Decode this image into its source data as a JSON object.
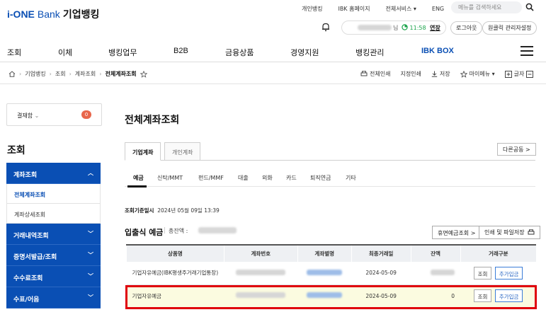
{
  "header": {
    "logo_brand": "i-ONE",
    "logo_bank": "Bank",
    "logo_kr": "기업뱅킹",
    "util_links": [
      "개인뱅킹",
      "IBK 홈페이지",
      "전체서비스 ▾",
      "ENG"
    ],
    "search_placeholder": "메뉴를 검색하세요",
    "user_suffix": "님",
    "timer": "11:58",
    "extend_label": "연장",
    "logout_label": "로그아웃",
    "cert_manager_label": "원클릭 관리자설정"
  },
  "gnb": [
    "조회",
    "이체",
    "뱅킹업무",
    "B2B",
    "금융상품",
    "경영지원",
    "뱅킹관리",
    "IBK BOX"
  ],
  "breadcrumb": [
    "기업뱅킹",
    "조회",
    "계좌조회",
    "전체계좌조회"
  ],
  "tools": [
    "전체인쇄",
    "지정인쇄",
    "저장",
    "마이메뉴 ▾",
    "글자"
  ],
  "sidebar": {
    "settle_label": "결재함",
    "settle_count": "0",
    "title": "조회",
    "sections": [
      {
        "label": "계좌조회",
        "open": true,
        "subs": [
          "전체계좌조회",
          "계좌상세조회"
        ]
      },
      {
        "label": "거래내역조회"
      },
      {
        "label": "증명서발급/조회"
      },
      {
        "label": "수수료조회"
      },
      {
        "label": "수표/어음"
      }
    ]
  },
  "main": {
    "title": "전체계좌조회",
    "account_tabs": [
      "기업계좌",
      "개인계좌"
    ],
    "others_button": "다른공동 >",
    "subtabs": [
      "예금",
      "신탁/MMT",
      "펀드/MMF",
      "대출",
      "외화",
      "카드",
      "퇴직연금",
      "기타"
    ],
    "inquiry_label": "조회기준일시",
    "inquiry_time": "2024년 05월 09일 13:39",
    "section_title": "입출식 예금",
    "total_label": "총잔액 :",
    "dormant_button": "휴면예금조회 >",
    "print_save_button": "인쇄 및 파일저장",
    "table": {
      "headers": [
        "상품명",
        "계좌번호",
        "계좌별명",
        "최종거래일",
        "잔액",
        "거래구분"
      ],
      "rows": [
        {
          "product": "기업자유예금(IBK평생주거래기업통장)",
          "last_date": "2024-05-09",
          "balance": "",
          "inquiry": "조회",
          "add_deposit": "추가입금"
        },
        {
          "product": "기업자유예금",
          "last_date": "2024-05-09",
          "balance": "0",
          "inquiry": "조회",
          "add_deposit": "추가입금"
        }
      ]
    }
  },
  "colors": {
    "brand": "#0a4fb4",
    "highlight_border": "#e0000b",
    "badge": "#e8664b"
  }
}
